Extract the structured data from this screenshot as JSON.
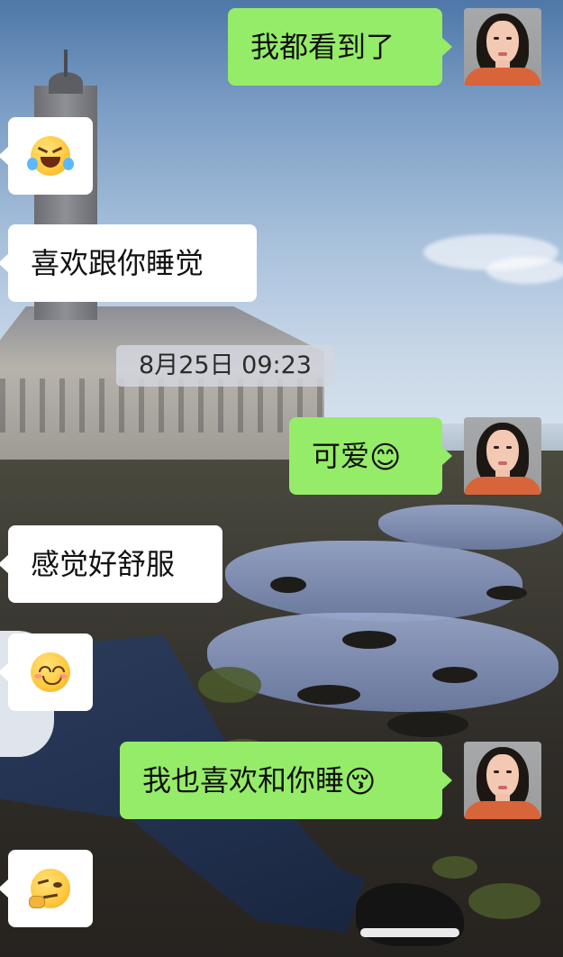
{
  "messages": [
    {
      "side": "right",
      "text": "我都看到了"
    },
    {
      "side": "left",
      "emoji": "rolling-on-floor-laughing-emoji"
    },
    {
      "side": "left",
      "text": "喜欢跟你睡觉"
    },
    {
      "side": "right",
      "text": "可爱",
      "emoji_suffix": "😊"
    },
    {
      "side": "left",
      "text": "感觉好舒服"
    },
    {
      "side": "left",
      "emoji": "smiling-face-emoji"
    },
    {
      "side": "right",
      "text": "我也喜欢和你睡",
      "emoji_suffix": "😚"
    },
    {
      "side": "left",
      "emoji": "thinking-face-emoji"
    }
  ],
  "timestamp": "8月25日 09:23",
  "colors": {
    "outgoing_bubble": "#95ec69",
    "incoming_bubble": "#ffffff",
    "timestamp_bg": "#d2d6de"
  }
}
